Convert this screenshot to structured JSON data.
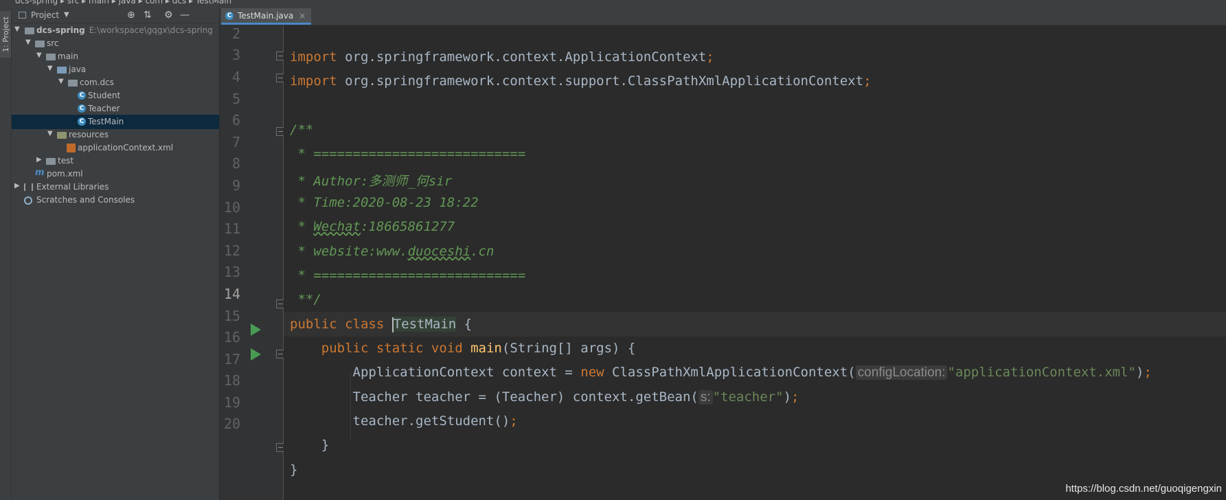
{
  "breadcrumbs": [
    "dcs-spring",
    "src",
    "main",
    "java",
    "com",
    "dcs",
    "TestMain"
  ],
  "toolwindow_tab": "1: Project",
  "project_panel": {
    "title": "Project",
    "tree": [
      {
        "label": "dcs-spring",
        "path": "E:\\workspace\\gqgx\\dcs-spring",
        "icon": "module-folder-icon",
        "expanded": true
      },
      {
        "label": "src",
        "icon": "folder-icon",
        "expanded": true
      },
      {
        "label": "main",
        "icon": "folder-icon",
        "expanded": true
      },
      {
        "label": "java",
        "icon": "source-folder-icon",
        "expanded": true
      },
      {
        "label": "com.dcs",
        "icon": "package-icon",
        "expanded": true
      },
      {
        "label": "Student",
        "icon": "class-icon"
      },
      {
        "label": "Teacher",
        "icon": "class-icon"
      },
      {
        "label": "TestMain",
        "icon": "class-icon",
        "selected": true
      },
      {
        "label": "resources",
        "icon": "resources-folder-icon",
        "expanded": true
      },
      {
        "label": "applicationContext.xml",
        "icon": "xml-file-icon"
      },
      {
        "label": "test",
        "icon": "folder-icon",
        "expanded": false
      },
      {
        "label": "pom.xml",
        "icon": "maven-icon"
      },
      {
        "label": "External Libraries",
        "icon": "libraries-icon",
        "expanded": false
      },
      {
        "label": "Scratches and Consoles",
        "icon": "scratches-icon"
      }
    ]
  },
  "editor": {
    "tab_label": "TestMain.java",
    "tab_close": "×",
    "line_numbers": [
      "2",
      "3",
      "4",
      "5",
      "6",
      "7",
      "8",
      "9",
      "10",
      "11",
      "12",
      "13",
      "14",
      "15",
      "16",
      "17",
      "18",
      "19",
      "20"
    ],
    "current_line": "14",
    "code": {
      "l3_kw": "import",
      "l3_rest": " org.springframework.context.ApplicationContext",
      "l3_semi": ";",
      "l4_kw": "import",
      "l4_rest": " org.springframework.context.support.ClassPathXmlApplicationContext",
      "l4_semi": ";",
      "l6": "/**",
      "l7": " * ===========================",
      "l8": " * Author:多测师_何sir",
      "l9": " * Time:2020-08-23 18:22",
      "l10_a": " * ",
      "l10_b": "Wechat",
      "l10_c": ":18665861277",
      "l11_a": " * website:www.",
      "l11_b": "duoceshi",
      "l11_c": ".cn",
      "l12": " * ===========================",
      "l13": " **/",
      "l14_kw": "public class ",
      "l14_name": "TestMain",
      "l14_rest": " {",
      "l15_kw": "    public static void ",
      "l15_fn": "main",
      "l15_rest": "(String[] args) {",
      "l16_a": "        ApplicationContext context = ",
      "l16_new": "new",
      "l16_b": " ClassPathXmlApplicationContext(",
      "l16_hint": "configLocation:",
      "l16_str": "\"applicationContext.xml\"",
      "l16_c": ")",
      "l16_semi": ";",
      "l17_a": "        Teacher teacher = (Teacher) context.getBean(",
      "l17_hint": "s:",
      "l17_str": "\"teacher\"",
      "l17_c": ")",
      "l17_semi": ";",
      "l18_a": "        teacher.getStudent()",
      "l18_semi": ";",
      "l19": "    }",
      "l20": "}"
    }
  },
  "watermark": "https://blog.csdn.net/guoqigengxin"
}
